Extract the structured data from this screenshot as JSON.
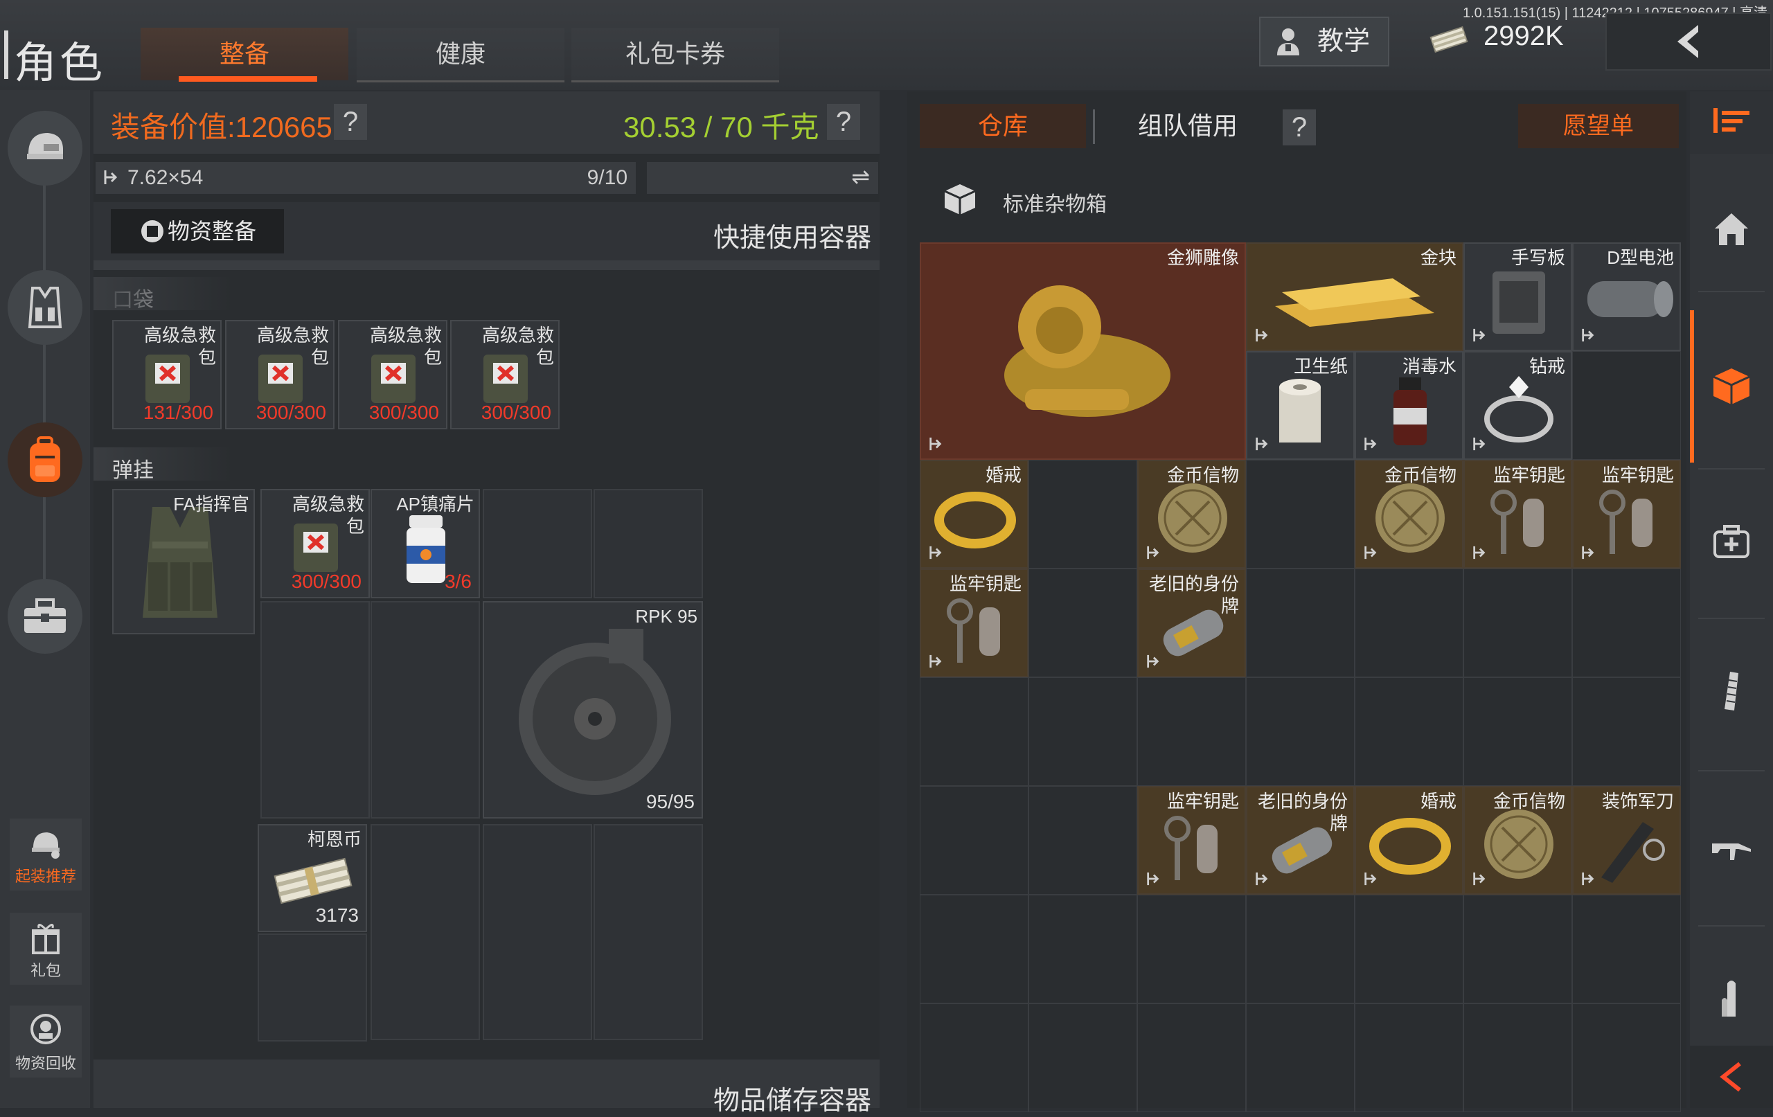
{
  "header": {
    "title": "角色",
    "tabs": [
      "整备",
      "健康",
      "礼包卡券"
    ],
    "active_tab": 0,
    "tutorial_label": "教学",
    "money": "2992K",
    "version_info": "1.0.151.151(15) | 11242212 | 10755286947 | 高清"
  },
  "left_rail": {
    "recommend_label": "起装推荐",
    "gift_label": "礼包",
    "recycle_label": "物资回收"
  },
  "loadout": {
    "equip_value_label": "装备价值:120665",
    "weight": "30.53 / 70 千克",
    "help": "?",
    "ammo_type": "7.62×54",
    "ammo_count": "9/10",
    "swap_icon": "⇌",
    "supplies_button": "物资整备",
    "quick_container": "快捷使用容器",
    "pockets_label": "口袋",
    "rig_label": "弹挂",
    "storage_label": "物品储存容器",
    "pockets": [
      {
        "name": "高级急救\n包",
        "count": "131/300"
      },
      {
        "name": "高级急救\n包",
        "count": "300/300"
      },
      {
        "name": "高级急救\n包",
        "count": "300/300"
      },
      {
        "name": "高级急救\n包",
        "count": "300/300"
      }
    ],
    "rig": {
      "name": "FA指挥官"
    },
    "rig_items": [
      {
        "name": "高级急救\n包",
        "count": "300/300"
      },
      {
        "name": "AP镇痛片",
        "count": "3/6"
      },
      {
        "name": "RPK 95",
        "count": "95/95"
      },
      {
        "name": "柯恩币",
        "count": "3173"
      }
    ]
  },
  "stash": {
    "tabs": [
      "仓库",
      "组队借用"
    ],
    "active_tab": 0,
    "help": "?",
    "wishlist": "愿望单",
    "container_name": "标准杂物箱",
    "items": [
      {
        "name": "金狮雕像",
        "rarity": "red"
      },
      {
        "name": "金块",
        "rarity": "gold"
      },
      {
        "name": "手写板",
        "rarity": "grey"
      },
      {
        "name": "D型电池",
        "rarity": "grey"
      },
      {
        "name": "卫生纸",
        "rarity": "grey"
      },
      {
        "name": "消毒水",
        "rarity": "grey"
      },
      {
        "name": "钻戒",
        "rarity": "grey"
      },
      {
        "name": "婚戒",
        "rarity": "gold"
      },
      {
        "name": "金币信物",
        "rarity": "gold"
      },
      {
        "name": "金币信物",
        "rarity": "gold"
      },
      {
        "name": "监牢钥匙",
        "rarity": "gold"
      },
      {
        "name": "监牢钥匙",
        "rarity": "gold"
      },
      {
        "name": "监牢钥匙",
        "rarity": "gold"
      },
      {
        "name": "老旧的身份\n牌",
        "rarity": "gold"
      },
      {
        "name": "监牢钥匙",
        "rarity": "gold"
      },
      {
        "name": "老旧的身份\n牌",
        "rarity": "gold"
      },
      {
        "name": "婚戒",
        "rarity": "gold"
      },
      {
        "name": "金币信物",
        "rarity": "gold"
      },
      {
        "name": "装饰军刀",
        "rarity": "gold"
      }
    ]
  },
  "colors": {
    "accent": "#ff6a1f",
    "weight_green": "#a4cf32",
    "count_red": "#f23a2a",
    "gold_bg": "#4a3b25",
    "red_bg": "#5a2e22"
  }
}
